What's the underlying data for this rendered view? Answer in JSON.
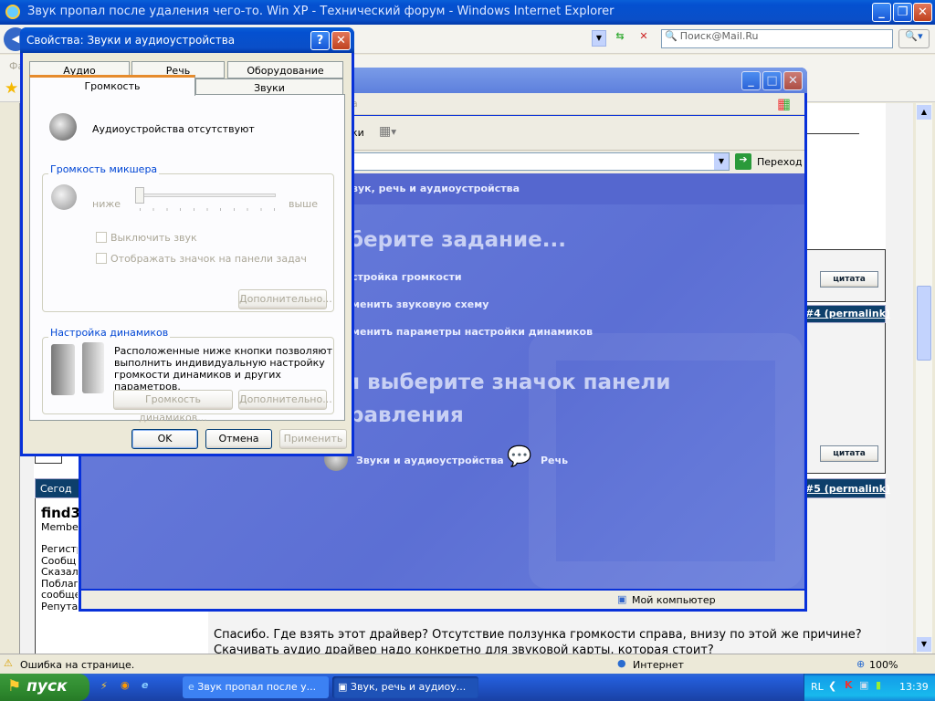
{
  "ie": {
    "title": "Звук пропал после удаления чего-то. Win XP - Технический форум - Windows Internet Explorer",
    "search_placeholder": "Поиск@Mail.Ru",
    "menu_partial": "Фа",
    "status_text": "Ошибка на странице.",
    "zone": "Интернет",
    "zoom": "100%"
  },
  "forum": {
    "quote_label": "цитата",
    "post4_link": "#4 (permalink)",
    "post5_link": "#5 (permalink)",
    "post5_date_partial": "Сегод",
    "post5_user_partial": "find3",
    "post5_role_partial": "Membe",
    "post5_info_partial": [
      "Регистр",
      "Сообщ",
      "Сказал",
      "Поблаг",
      "сообще",
      "Репута"
    ],
    "post5_text": [
      "Спасибо. Где взять этот драйвер? Отсутствие ползунка громкости справа, внизу по этой же причине?",
      "Скачивать аудио драйвер надо конкретно для звуковой карты, которая стоит?"
    ]
  },
  "cpanel": {
    "menu_partial": "а",
    "toolbar_partial": "ки",
    "go_label": "Переход",
    "header_partial": "вук, речь и аудиоустройства",
    "pick_task_partial": "берите задание...",
    "tasks_partial": [
      "стройка громкости",
      "менить звуковую схему",
      "менить параметры настройки динамиков"
    ],
    "pick_icon_partial": [
      "и выберите значок панели",
      "равления"
    ],
    "icons": [
      {
        "label": "Звуки и аудиоустройства",
        "icon": "speaker-icon"
      },
      {
        "label": "Речь",
        "icon": "speech-icon"
      }
    ],
    "status": "Мой компьютер"
  },
  "dialog": {
    "title": "Свойства: Звуки и аудиоустройства",
    "tabs_row1": [
      "Аудио",
      "Речь",
      "Оборудование"
    ],
    "tabs_row2": [
      "Громкость",
      "Звуки"
    ],
    "no_devices": "Аудиоустройства отсутствуют",
    "mixer_group": "Громкость микшера",
    "low": "ниже",
    "high": "выше",
    "volume_level": 0,
    "mute": "Выключить звук",
    "tray_icon": "Отображать значок на панели задач",
    "advanced": "Дополнительно...",
    "speakers_group": "Настройка динамиков",
    "speakers_text": "Расположенные ниже кнопки позволяют выполнить индивидуальную настройку громкости динамиков и других параметров.",
    "speaker_volume": "Громкость динамиков...",
    "ok": "OK",
    "cancel": "Отмена",
    "apply": "Применить"
  },
  "taskbar": {
    "start": "пуск",
    "tasks": [
      "Звук пропал после у...",
      "Звук, речь и аудиоу..."
    ],
    "lang": "RL",
    "clock": "13:39"
  }
}
